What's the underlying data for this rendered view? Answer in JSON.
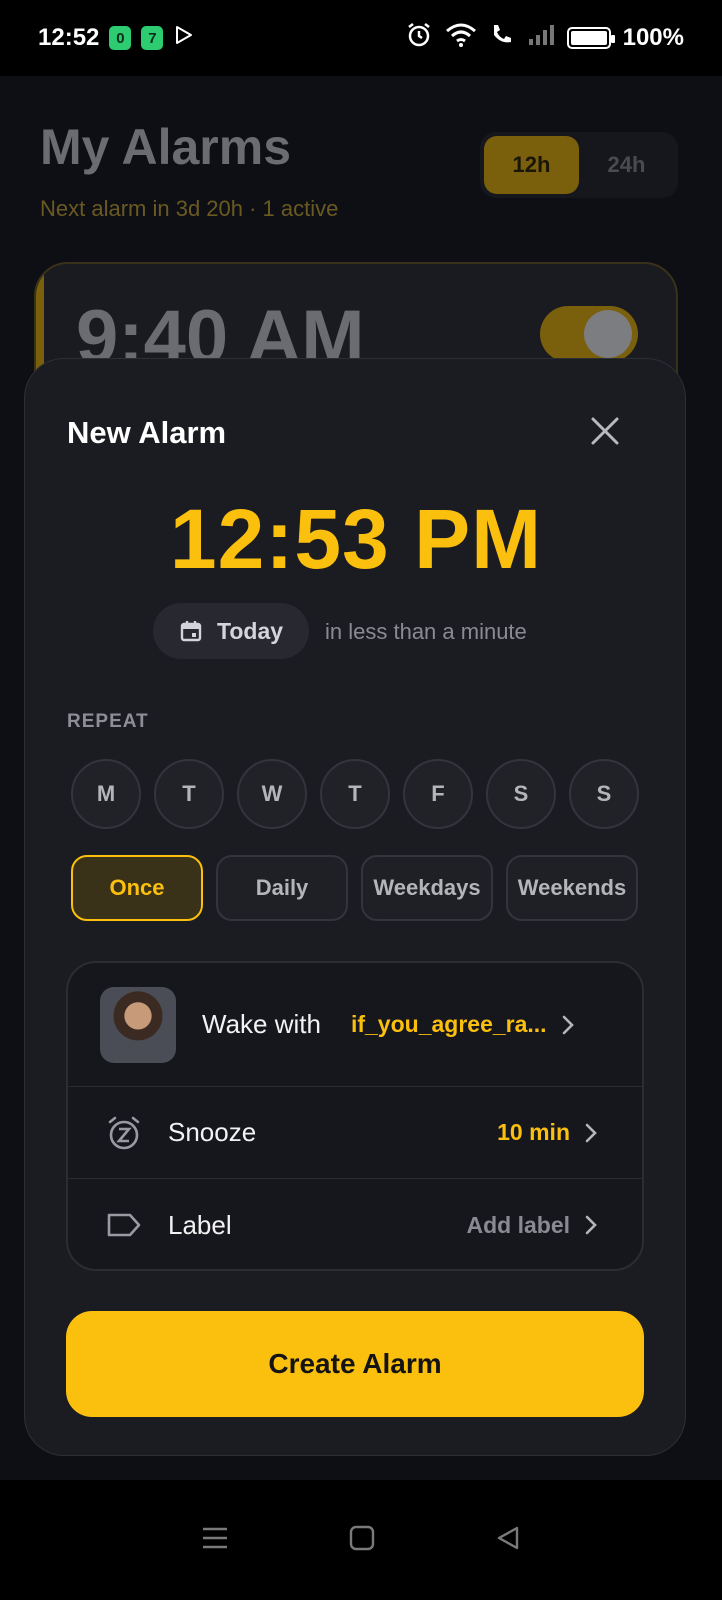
{
  "status_bar": {
    "time": "12:52",
    "badge_1": "0",
    "badge_2": "7",
    "battery": "100%"
  },
  "background": {
    "title": "My Alarms",
    "subtitle": "Next alarm in 3d 20h · 1 active",
    "format_options": [
      "12h",
      "24h"
    ],
    "format_selected": "12h",
    "alarm_time": "9:40 AM",
    "alarm_enabled": true
  },
  "sheet": {
    "title": "New Alarm",
    "time": "12:53 PM",
    "date_chip": "Today",
    "date_hint": "in less than a minute",
    "repeat_label": "REPEAT",
    "days": [
      "M",
      "T",
      "W",
      "T",
      "F",
      "S",
      "S"
    ],
    "presets": [
      "Once",
      "Daily",
      "Weekdays",
      "Weekends"
    ],
    "preset_selected": "Once",
    "wake_label": "Wake with",
    "wake_value": "if_you_agree_ra...",
    "snooze_label": "Snooze",
    "snooze_value": "10 min",
    "label_label": "Label",
    "label_value": "Add label",
    "create_button": "Create Alarm"
  },
  "colors": {
    "accent": "#fbbf0e",
    "sheet_bg": "#1b1c22",
    "page_bg": "#000000"
  }
}
